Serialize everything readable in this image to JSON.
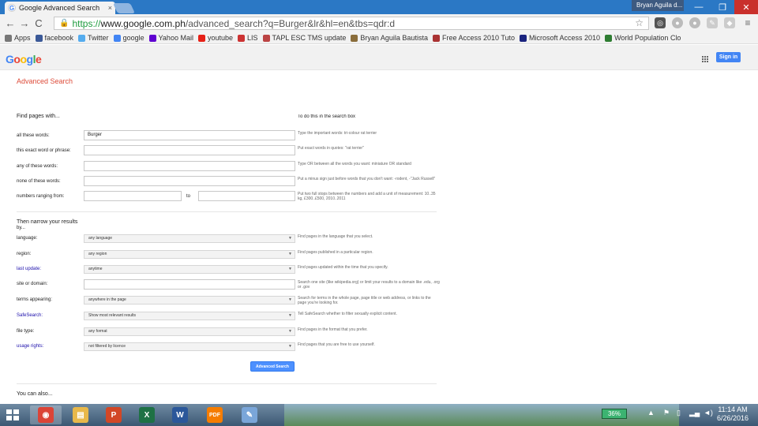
{
  "browser": {
    "tab_title": "Google Advanced Search",
    "tab_close": "×",
    "user_name": "Bryan Aguila d...",
    "window_controls": [
      "—",
      "❐",
      "✕"
    ],
    "url_scheme": "https://",
    "url_host": "www.google.com.ph",
    "url_path": "/advanced_search?q=Burger&lr&hl=en&tbs=qdr:d",
    "nav": {
      "back": "←",
      "forward": "→",
      "reload": "C"
    },
    "menu_icon": "≡"
  },
  "bookmarks": [
    {
      "label": "Apps",
      "icon": "apps-icon",
      "color": "#777777"
    },
    {
      "label": "facebook",
      "icon": "facebook-icon",
      "color": "#3b5998"
    },
    {
      "label": "Twitter",
      "icon": "twitter-icon",
      "color": "#55acee"
    },
    {
      "label": "google",
      "icon": "google-icon",
      "color": "#4285f4"
    },
    {
      "label": "Yahoo Mail",
      "icon": "yahoo-icon",
      "color": "#5f01d1"
    },
    {
      "label": "youtube",
      "icon": "youtube-icon",
      "color": "#e62117"
    },
    {
      "label": "LIS",
      "icon": "lis-icon",
      "color": "#cc3333"
    },
    {
      "label": "TAPL ESC TMS update",
      "icon": "tapl-icon",
      "color": "#bb4444"
    },
    {
      "label": "Bryan Aguila Bautista",
      "icon": "profile-icon",
      "color": "#8a6d3b"
    },
    {
      "label": "Free Access 2010 Tuto",
      "icon": "access-icon",
      "color": "#a33"
    },
    {
      "label": "Microsoft Access 2010",
      "icon": "msaccess-icon",
      "color": "#1a237e"
    },
    {
      "label": "World Population Clo",
      "icon": "globe-icon",
      "color": "#2e7d32"
    }
  ],
  "google": {
    "logo_letters": [
      "G",
      "o",
      "o",
      "g",
      "l",
      "e"
    ],
    "logo_colors": [
      "#4285f4",
      "#ea4335",
      "#fbbc05",
      "#4285f4",
      "#34a853",
      "#ea4335"
    ],
    "signin_label": "Sign in"
  },
  "page": {
    "title": "Advanced Search",
    "find_heading": "Find pages with...",
    "hint_heading": "To do this in the search box",
    "find_rows": [
      {
        "label": "all these words:",
        "value": "Burger",
        "hint": "Type the important words: tri-colour rat terrier"
      },
      {
        "label": "this exact word or phrase:",
        "value": "",
        "hint": "Put exact words in quotes: \"rat terrier\""
      },
      {
        "label": "any of these words:",
        "value": "",
        "hint": "Type OR between all the words you want: miniature OR standard"
      },
      {
        "label": "none of these words:",
        "value": "",
        "hint": "Put a minus sign just before words that you don't want: -rodent, -\"Jack Russell\""
      },
      {
        "label": "numbers ranging from:",
        "value": "",
        "hint": "Put two full stops between the numbers and add a unit of measurement: 10..35 kg, £300..£500, 2010..2011"
      }
    ],
    "range_to": "to",
    "narrow_heading": "Then narrow your results",
    "narrow_by": "by...",
    "narrow_rows": [
      {
        "label": "language:",
        "value": "any language",
        "type": "select",
        "hint": "Find pages in the language that you select."
      },
      {
        "label": "region:",
        "value": "any region",
        "type": "select",
        "hint": "Find pages published in a particular region."
      },
      {
        "label": "last update:",
        "value": "anytime",
        "type": "select",
        "hint": "Find pages updated within the time that you specify."
      },
      {
        "label": "site or domain:",
        "value": "",
        "type": "text",
        "hint": "Search one site (like wikipedia.org) or limit your results to a domain like .edu, .org or .gov"
      },
      {
        "label": "terms appearing:",
        "value": "anywhere in the page",
        "type": "select",
        "hint": "Search for terms in the whole page, page title or web address, or links to the page you're looking for."
      },
      {
        "label": "SafeSearch:",
        "value": "Show most relevant results",
        "type": "select",
        "hint": "Tell SafeSearch whether to filter sexually explicit content."
      },
      {
        "label": "file type:",
        "value": "any format",
        "type": "select",
        "hint": "Find pages in the format that you prefer."
      },
      {
        "label": "usage rights:",
        "value": "not filtered by licence",
        "type": "select",
        "hint": "Find pages that you are free to use yourself."
      }
    ],
    "advanced_button": "Advanced Search",
    "you_can_also": "You can also..."
  },
  "taskbar": {
    "apps": [
      {
        "name": "chrome",
        "icon": "chrome-icon",
        "color": "#db4437",
        "glyph": "◉"
      },
      {
        "name": "explorer",
        "icon": "folder-icon",
        "color": "#e8b84a",
        "glyph": "▤"
      },
      {
        "name": "powerpoint",
        "icon": "powerpoint-icon",
        "color": "#d24726",
        "glyph": "P"
      },
      {
        "name": "excel",
        "icon": "excel-icon",
        "color": "#1e7145",
        "glyph": "X"
      },
      {
        "name": "word",
        "icon": "word-icon",
        "color": "#2b579a",
        "glyph": "W"
      },
      {
        "name": "pdf",
        "icon": "pdf-icon",
        "color": "#f57c00",
        "glyph": "PDF"
      },
      {
        "name": "paint",
        "icon": "paint-icon",
        "color": "#7aa6d9",
        "glyph": "✎"
      }
    ],
    "battery": "36%",
    "time": "11:14 AM",
    "date": "6/26/2016"
  }
}
